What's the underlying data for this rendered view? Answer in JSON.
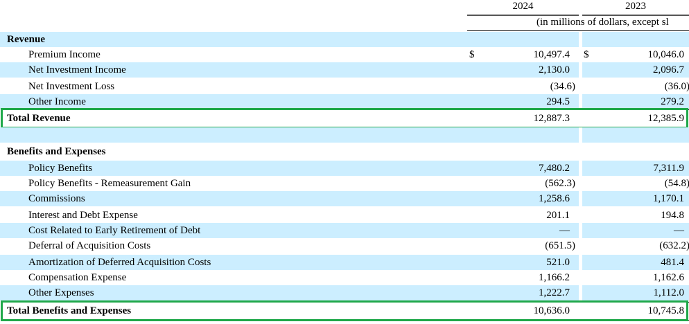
{
  "header": {
    "col1": "2024",
    "col2": "2023",
    "units": "(in millions of dollars, except sl"
  },
  "currency_symbol": "$",
  "rows": [
    {
      "label": "Revenue",
      "bold": true,
      "v1": "",
      "v2": ""
    },
    {
      "label": "Premium Income",
      "v1": "10,497.4",
      "v2": "10,046.0",
      "dollar": true
    },
    {
      "label": "Net Investment Income",
      "v1": "2,130.0",
      "v2": "2,096.7"
    },
    {
      "label": "Net Investment Loss",
      "v1": "(34.6)",
      "v2": "(36.0)"
    },
    {
      "label": "Other Income",
      "v1": "294.5",
      "v2": "279.2"
    },
    {
      "label": "Total Revenue",
      "bold": true,
      "v1": "12,887.3",
      "v2": "12,385.9",
      "highlight": true
    },
    {
      "label": "",
      "v1": "",
      "v2": ""
    },
    {
      "label": "Benefits and Expenses",
      "bold": true,
      "v1": "",
      "v2": ""
    },
    {
      "label": "Policy Benefits",
      "v1": "7,480.2",
      "v2": "7,311.9"
    },
    {
      "label": "Policy Benefits - Remeasurement Gain",
      "v1": "(562.3)",
      "v2": "(54.8)"
    },
    {
      "label": "Commissions",
      "v1": "1,258.6",
      "v2": "1,170.1"
    },
    {
      "label": "Interest and Debt Expense",
      "v1": "201.1",
      "v2": "194.8"
    },
    {
      "label": "Cost Related to Early Retirement of Debt",
      "v1": "—",
      "v2": "—"
    },
    {
      "label": "Deferral of Acquisition Costs",
      "v1": "(651.5)",
      "v2": "(632.2)"
    },
    {
      "label": "Amortization of Deferred Acquisition Costs",
      "v1": "521.0",
      "v2": "481.4"
    },
    {
      "label": "Compensation Expense",
      "v1": "1,166.2",
      "v2": "1,162.6"
    },
    {
      "label": "Other Expenses",
      "v1": "1,222.7",
      "v2": "1,112.0"
    },
    {
      "label": "Total Benefits and Expenses",
      "bold": true,
      "v1": "10,636.0",
      "v2": "10,745.8",
      "highlight": true
    }
  ],
  "colors": {
    "row_shade": "#cceeff",
    "highlight": "#1fa84a"
  }
}
